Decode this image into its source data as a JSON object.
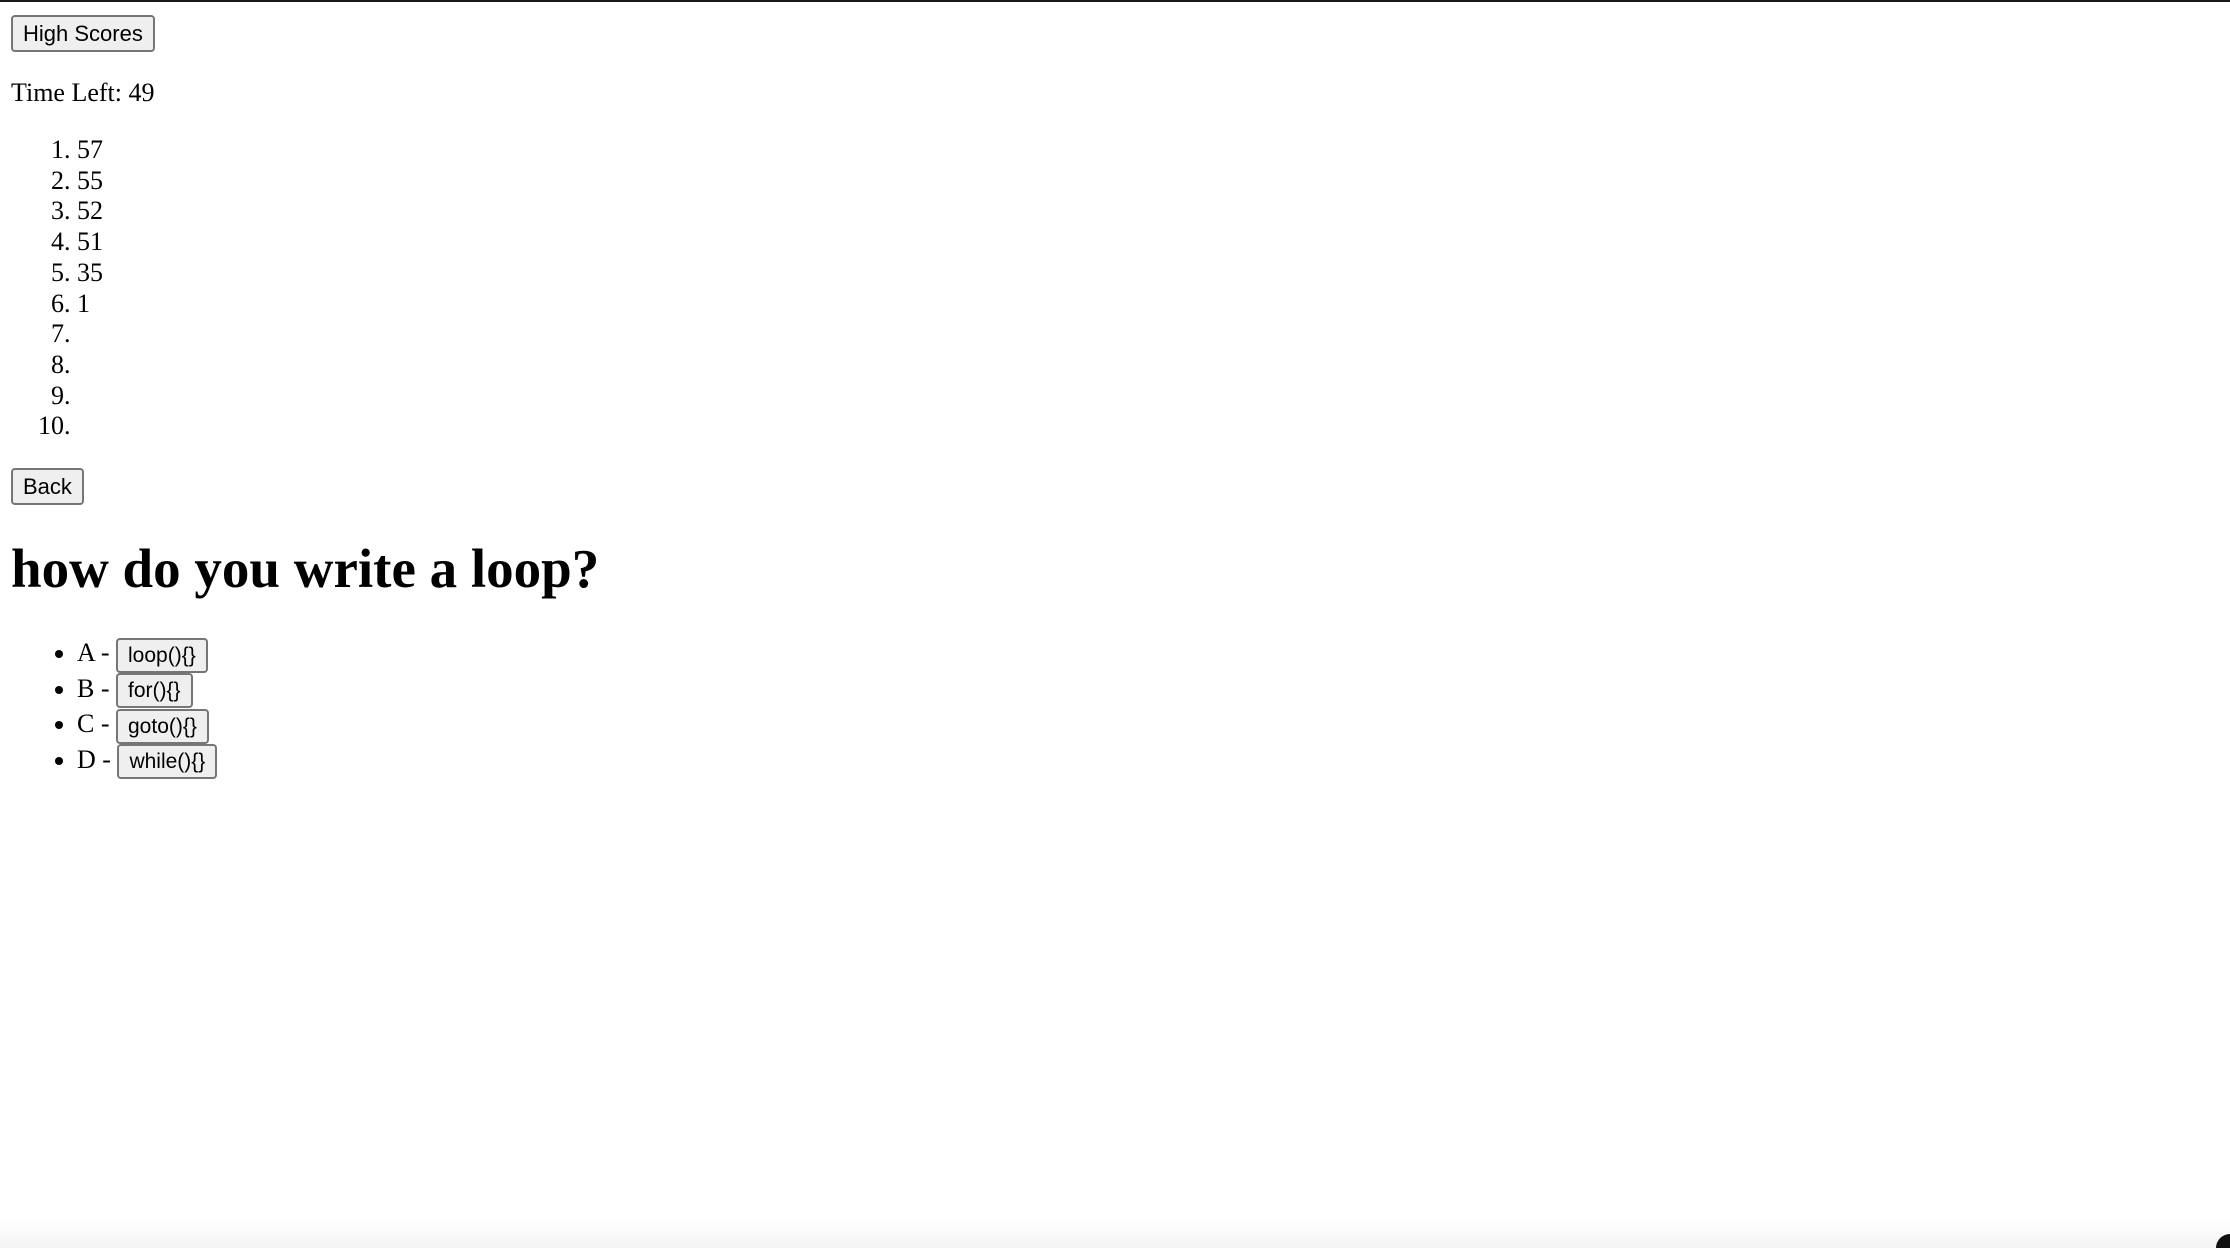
{
  "header": {
    "high_scores_label": "High Scores"
  },
  "timer": {
    "label": "Time Left:",
    "value": "49"
  },
  "high_scores": {
    "items": [
      "57",
      "55",
      "52",
      "51",
      "35",
      "1",
      "",
      "",
      "",
      ""
    ],
    "back_label": "Back"
  },
  "quiz": {
    "question": "how do you write a loop?",
    "choices": [
      {
        "letter": "A -",
        "answer": "loop(){}"
      },
      {
        "letter": "B -",
        "answer": "for(){}"
      },
      {
        "letter": "C -",
        "answer": "goto(){}"
      },
      {
        "letter": "D -",
        "answer": "while(){}"
      }
    ]
  }
}
